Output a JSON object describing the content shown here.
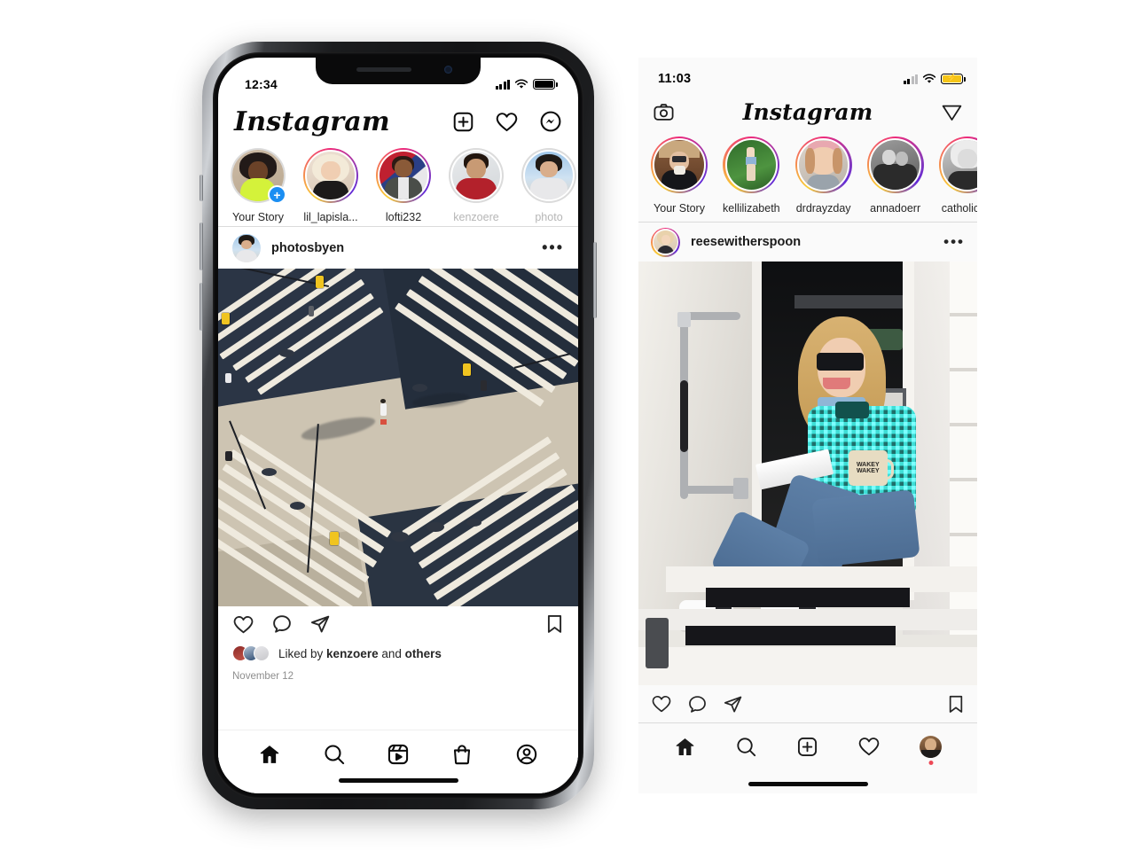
{
  "page": {
    "background": "#ffffff",
    "description": "Two Instagram mobile feed views side by side: a device mockup on the left and a raw iPhone screenshot on the right"
  },
  "left_phone": {
    "device": "iPhone X style mockup",
    "frame_color": "#1b1c1e",
    "status_bar": {
      "time": "12:34",
      "cellular_icon": "signal-bars-icon",
      "wifi_icon": "wifi-icon",
      "battery_icon": "battery-full-icon",
      "battery_state": "full"
    },
    "header": {
      "logo": "Instagram",
      "actions": [
        {
          "name": "new-post-button",
          "icon": "plus-box-icon"
        },
        {
          "name": "activity-button",
          "icon": "heart-icon"
        },
        {
          "name": "messenger-button",
          "icon": "messenger-icon"
        }
      ]
    },
    "stories": [
      {
        "label": "Your Story",
        "ring": "none",
        "has_add_badge": true,
        "seen": false,
        "add_badge": "+"
      },
      {
        "label": "lil_lapisla...",
        "ring": "gradient",
        "has_add_badge": false,
        "seen": false
      },
      {
        "label": "lofti232",
        "ring": "gradient",
        "has_add_badge": false,
        "seen": false
      },
      {
        "label": "kenzoere",
        "ring": "seen",
        "has_add_badge": false,
        "seen": true
      },
      {
        "label": "photo",
        "ring": "seen",
        "has_add_badge": false,
        "seen": true
      }
    ],
    "post": {
      "username": "photosbyen",
      "menu_icon": "more-options-icon",
      "image_alt": "Aerial top-down photo of a city intersection with white crosswalk stripes and long shadows",
      "actions": [
        {
          "name": "like-button",
          "icon": "heart-icon"
        },
        {
          "name": "comment-button",
          "icon": "comment-bubble-icon"
        },
        {
          "name": "share-button",
          "icon": "paper-plane-icon"
        },
        {
          "name": "save-button",
          "icon": "bookmark-icon"
        }
      ],
      "likes_prefix": "Liked by ",
      "likes_user": "kenzoere",
      "likes_middle": " and ",
      "likes_suffix": "others",
      "date": "November 12"
    },
    "tabbar": [
      {
        "name": "tab-home",
        "icon": "home-icon",
        "active": true
      },
      {
        "name": "tab-search",
        "icon": "search-icon",
        "active": false
      },
      {
        "name": "tab-reels",
        "icon": "reels-icon",
        "active": false
      },
      {
        "name": "tab-shop",
        "icon": "shop-bag-icon",
        "active": false
      },
      {
        "name": "tab-profile",
        "icon": "profile-circle-icon",
        "active": false
      }
    ]
  },
  "right_screenshot": {
    "status_bar": {
      "time": "11:03",
      "cellular_icon": "signal-bars-icon",
      "wifi_icon": "wifi-icon",
      "battery_icon": "battery-charging-icon",
      "battery_state": "charging",
      "battery_color": "#f5c518"
    },
    "header": {
      "logo": "Instagram",
      "left_action": {
        "name": "camera-button",
        "icon": "camera-icon"
      },
      "right_action": {
        "name": "direct-messages-button",
        "icon": "paper-plane-icon"
      }
    },
    "stories": [
      {
        "label": "Your Story",
        "ring": "gradient"
      },
      {
        "label": "kellilizabeth",
        "ring": "gradient"
      },
      {
        "label": "drdrayzday",
        "ring": "gradient"
      },
      {
        "label": "annadoerr",
        "ring": "gradient"
      },
      {
        "label": "catholicwif",
        "ring": "gradient"
      }
    ],
    "post": {
      "username": "reesewitherspoon",
      "menu_icon": "more-options-icon",
      "image_alt": "Blonde woman in sunglasses and a green gingham sweater sitting in a trailer doorway holding a WAKEY WAKEY mug",
      "mug_text_line1": "WAKEY",
      "mug_text_line2": "WAKEY",
      "actions": [
        {
          "name": "like-button",
          "icon": "heart-icon"
        },
        {
          "name": "comment-button",
          "icon": "comment-bubble-icon"
        },
        {
          "name": "share-button",
          "icon": "paper-plane-icon"
        },
        {
          "name": "save-button",
          "icon": "bookmark-icon"
        }
      ]
    },
    "tabbar": [
      {
        "name": "tab-home",
        "icon": "home-icon",
        "active": true
      },
      {
        "name": "tab-search",
        "icon": "search-icon",
        "active": false
      },
      {
        "name": "tab-add",
        "icon": "plus-box-icon",
        "active": false
      },
      {
        "name": "tab-activity",
        "icon": "heart-icon",
        "active": false
      },
      {
        "name": "tab-profile",
        "icon": "avatar-icon",
        "active": false,
        "badge": true,
        "badge_color": "#ed4956"
      }
    ]
  },
  "colors": {
    "ig_gradient_start": "#f9ce34",
    "ig_gradient_mid": "#ee2a7b",
    "ig_gradient_end": "#6228d7",
    "seen_ring": "#dbdbdb",
    "text_primary": "#262626",
    "text_muted": "#8e8e8e",
    "divider": "#dbdbdb",
    "badge_red": "#ed4956",
    "add_blue": "#1b8ef2"
  }
}
